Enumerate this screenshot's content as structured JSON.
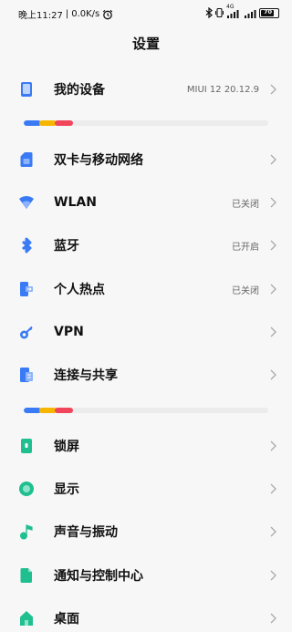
{
  "status_bar": {
    "time": "晚上11:27",
    "speed": "0.0K/s",
    "battery_level": "70",
    "network": "4G"
  },
  "page": {
    "title": "设置"
  },
  "rows": [
    {
      "id": "my-device",
      "label": "我的设备",
      "value": "MIUI 12 20.12.9",
      "icon": "phone-icon"
    },
    {
      "id": "dual-sim",
      "label": "双卡与移动网络",
      "value": "",
      "icon": "sim-card-icon"
    },
    {
      "id": "wlan",
      "label": "WLAN",
      "value": "已关闭",
      "icon": "wifi-icon"
    },
    {
      "id": "bluetooth",
      "label": "蓝牙",
      "value": "已开启",
      "icon": "bluetooth-icon"
    },
    {
      "id": "hotspot",
      "label": "个人热点",
      "value": "已关闭",
      "icon": "hotspot-icon"
    },
    {
      "id": "vpn",
      "label": "VPN",
      "value": "",
      "icon": "vpn-key-icon"
    },
    {
      "id": "connection-sharing",
      "label": "连接与共享",
      "value": "",
      "icon": "connection-sharing-icon"
    },
    {
      "id": "lock-screen",
      "label": "锁屏",
      "value": "",
      "icon": "lock-screen-icon"
    },
    {
      "id": "display",
      "label": "显示",
      "value": "",
      "icon": "display-icon"
    },
    {
      "id": "sound",
      "label": "声音与振动",
      "value": "",
      "icon": "music-note-icon"
    },
    {
      "id": "notifications",
      "label": "通知与控制中心",
      "value": "",
      "icon": "notification-icon"
    },
    {
      "id": "home-screen",
      "label": "桌面",
      "value": "",
      "icon": "home-icon"
    }
  ],
  "colors": {
    "blue": "#3a7bf5",
    "yellow": "#f6b600",
    "red": "#f0455a",
    "green": "#1fbf8f"
  }
}
